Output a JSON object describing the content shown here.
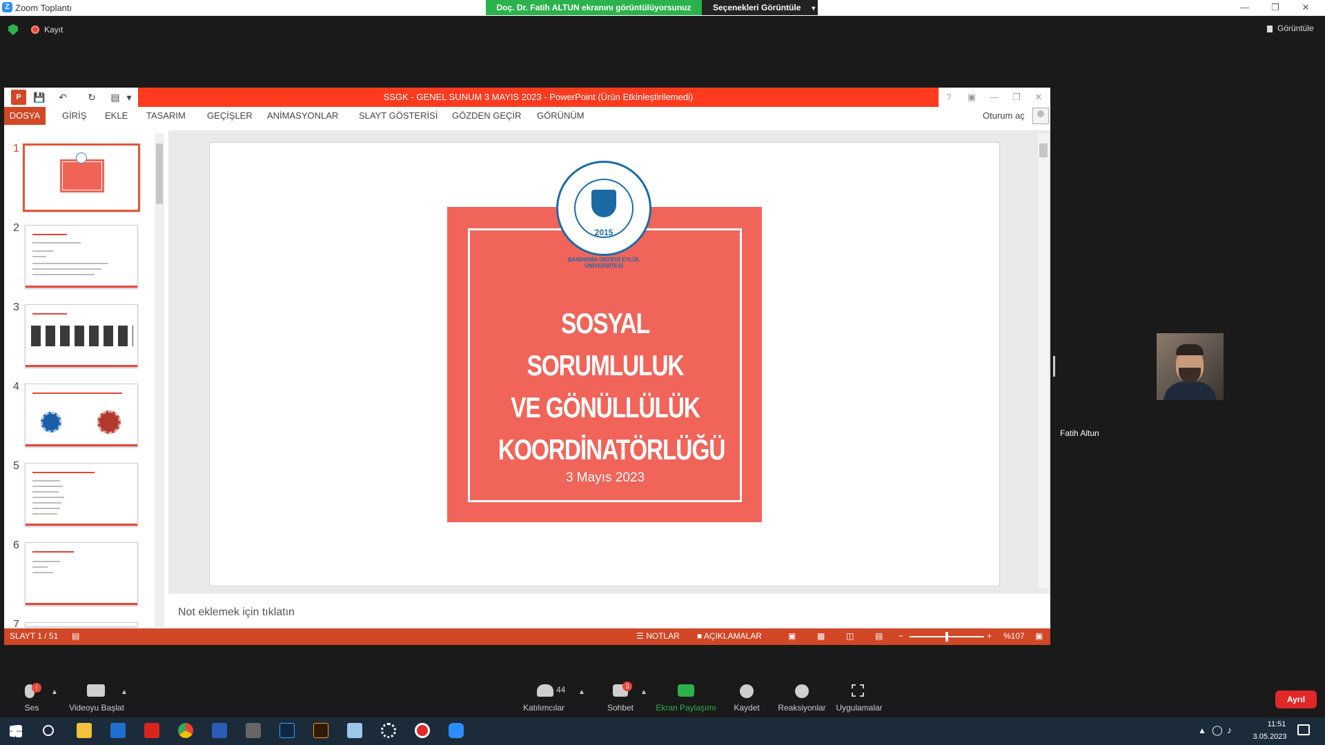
{
  "zoom": {
    "title": "Zoom Toplantı",
    "share_banner": "Doç. Dr. Fatih ALTUN ekranını görüntülüyorsunuz",
    "view_options": "Seçenekleri Görüntüle",
    "recording_label": "Kayıt",
    "view_button": "Görüntüle",
    "participant_name": "Fatih Altun",
    "toolbar": {
      "audio": "Ses",
      "video": "Videoyu Başlat",
      "participants": "Katılımcılar",
      "participants_count": "44",
      "chat": "Sohbet",
      "chat_badge": "3",
      "share": "Ekran Paylaşımı",
      "record": "Kaydet",
      "reactions": "Reaksiyonlar",
      "apps": "Uygulamalar",
      "leave": "Ayrıl"
    }
  },
  "powerpoint": {
    "title": "SSGK - GENEL SUNUM 3 MAYIS 2023 -  PowerPoint (Ürün Etkinleştirilemedi)",
    "tabs": [
      "DOSYA",
      "GİRİŞ",
      "EKLE",
      "TASARIM",
      "GEÇİŞLER",
      "ANİMASYONLAR",
      "SLAYT GÖSTERİSİ",
      "GÖZDEN GEÇİR",
      "GÖRÜNÜM"
    ],
    "signin": "Oturum aç",
    "slide_numbers": [
      "1",
      "2",
      "3",
      "4",
      "5",
      "6",
      "7"
    ],
    "slide": {
      "title_line1": "SOSYAL SORUMLULUK",
      "title_line2": "VE GÖNÜLLÜLÜK",
      "title_line3": "KOORDİNATÖRLÜĞÜ",
      "date": "3 Mayıs 2023",
      "logo_ring": "BANDIRMA ONYEDİ EYLÜL ÜNİVERSİTESİ",
      "logo_year": "2015"
    },
    "notes_placeholder": "Not eklemek için tıklatın",
    "status": {
      "slide_counter": "SLAYT 1 / 51",
      "notes": "NOTLAR",
      "comments": "AÇIKLAMALAR",
      "zoom_level": "%107"
    }
  },
  "taskbar": {
    "time": "11:51",
    "date": "3.05.2023"
  },
  "colors": {
    "ppt_accent": "#d24726",
    "slide_red": "#f0645a",
    "zoom_green": "#2bb24c",
    "leave_red": "#e02828"
  }
}
